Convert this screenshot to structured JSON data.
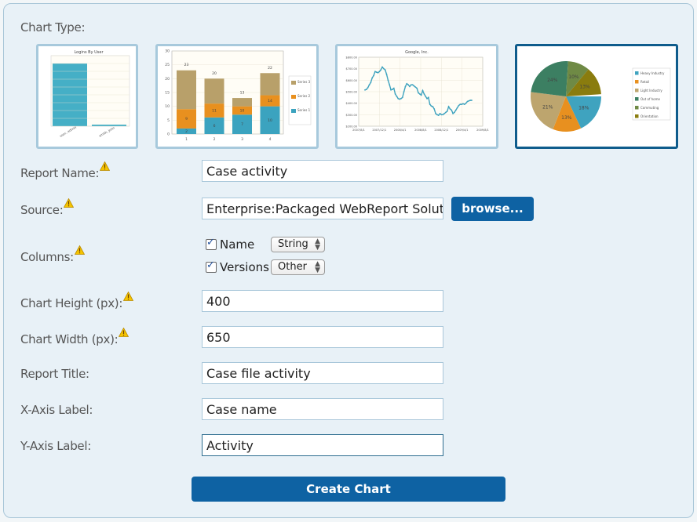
{
  "form": {
    "chart_type_label": "Chart Type:",
    "chart_types": [
      {
        "name": "bar",
        "title": "Logins By User",
        "categories": [
          "user, admin",
          "smith, john"
        ],
        "values": [
          80,
          2
        ],
        "selected": false
      },
      {
        "name": "stacked-bar",
        "categories": [
          "1",
          "2",
          "3",
          "4"
        ],
        "series": [
          {
            "name": "Series 1",
            "values": [
              2,
              6,
              7,
              10
            ]
          },
          {
            "name": "Series 2",
            "values": [
              7,
              5,
              3,
              4
            ]
          },
          {
            "name": "Series 3",
            "values": [
              14,
              9,
              3,
              8
            ]
          }
        ],
        "segment_labels": [
          [
            "2",
            "9",
            "23"
          ],
          [
            "6",
            "11",
            "20"
          ],
          [
            "7",
            "10",
            "13"
          ],
          [
            "10",
            "14",
            "22"
          ]
        ],
        "yticks": [
          "0",
          "5",
          "10",
          "15",
          "20",
          "25",
          "30"
        ],
        "legend": [
          "Series 3",
          "Series 2",
          "Series 1"
        ],
        "selected": false
      },
      {
        "name": "line",
        "title": "Google, Inc.",
        "yticks": [
          "$200.00",
          "$300.00",
          "$400.00",
          "$500.00",
          "$600.00",
          "$700.00",
          "$800.00"
        ],
        "xticks": [
          "2007/8/1",
          "2007/12/1",
          "2008/4/1",
          "2008/8/1",
          "2008/12/1",
          "2009/4/1",
          "2009/8/1"
        ],
        "selected": false
      },
      {
        "name": "pie",
        "slices": [
          {
            "label": "Heavy Industry",
            "pct": 18,
            "color": "#3fa3bf"
          },
          {
            "label": "Retail",
            "pct": 13,
            "color": "#e8901f"
          },
          {
            "label": "Light Industry",
            "pct": 21,
            "color": "#bda56e"
          },
          {
            "label": "Out of home",
            "pct": 24,
            "color": "#3c7f62"
          },
          {
            "label": "Commuting",
            "pct": 10,
            "color": "#6f8a45"
          },
          {
            "label": "Orientation",
            "pct": 13,
            "color": "#8a7c0e"
          }
        ],
        "selected": true
      }
    ],
    "report_name": {
      "label": "Report Name:",
      "value": "Case activity"
    },
    "source": {
      "label": "Source:",
      "value": "Enterprise:Packaged WebReport Solutio",
      "browse_label": "browse..."
    },
    "columns": {
      "label": "Columns:",
      "items": [
        {
          "name": "Name",
          "checked": true,
          "type": "String"
        },
        {
          "name": "Versions",
          "checked": true,
          "type": "Other"
        }
      ]
    },
    "chart_height": {
      "label": "Chart Height (px):",
      "value": "400"
    },
    "chart_width": {
      "label": "Chart Width (px):",
      "value": "650"
    },
    "report_title": {
      "label": "Report Title:",
      "value": "Case file activity"
    },
    "x_axis_label": {
      "label": "X-Axis Label:",
      "value": "Case name"
    },
    "y_axis_label": {
      "label": "Y-Axis Label:",
      "value": "Activity"
    },
    "create_label": "Create Chart"
  },
  "colors": {
    "accent": "#0e62a3",
    "panel_bg": "#e8f1f7",
    "selected_border": "#0f5c8c"
  }
}
